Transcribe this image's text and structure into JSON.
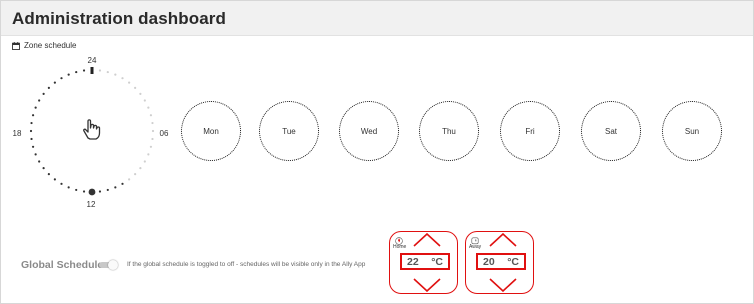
{
  "header": {
    "title": "Administration dashboard"
  },
  "zone_schedule": {
    "label": "Zone schedule",
    "icon": "calendar-icon"
  },
  "clock": {
    "labels": {
      "top": "24",
      "right": "06",
      "bottom": "12",
      "left": "18"
    },
    "icon": "hand-pointer-icon"
  },
  "days": [
    "Mon",
    "Tue",
    "Wed",
    "Thu",
    "Fri",
    "Sat",
    "Sun"
  ],
  "global_schedule": {
    "label": "Global Schedule",
    "toggle_on": false,
    "note": "If the global schedule is toggled to off - schedules will be visible only in the Ally App"
  },
  "presets": [
    {
      "label": "Home",
      "icon": "flame-icon",
      "value": "22",
      "unit": "°C"
    },
    {
      "label": "Away",
      "icon": "away-icon",
      "value": "20",
      "unit": "°C"
    }
  ],
  "colors": {
    "accent_red": "#e01010",
    "text_dark": "#2a2a2a"
  }
}
